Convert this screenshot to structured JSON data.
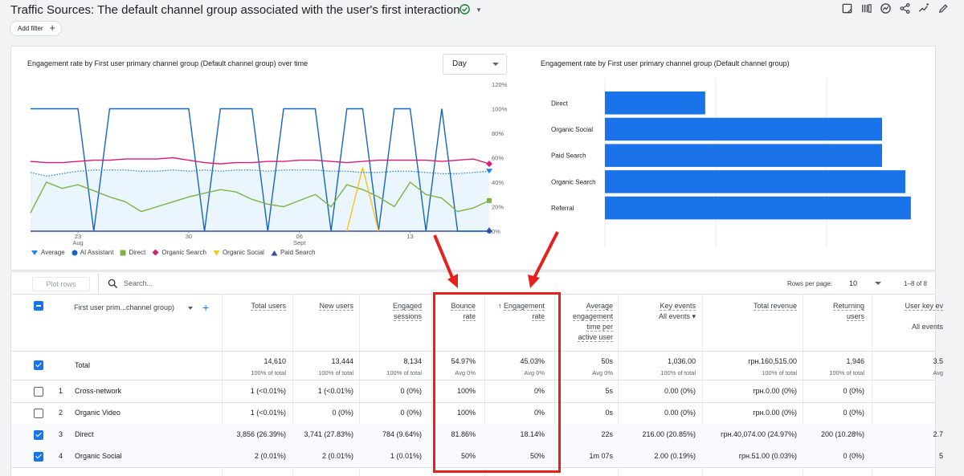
{
  "header": {
    "title": "Traffic Sources: The default channel group associated with the user's first interaction",
    "add_filter": "Add filter"
  },
  "line_chart": {
    "title": "Engagement rate by First user primary channel group (Default channel group) over time",
    "granularity": "Day",
    "y_ticks": [
      "120%",
      "100%",
      "80%",
      "60%",
      "40%",
      "20%",
      "0%"
    ],
    "x_ticks": [
      {
        "day": "23",
        "month": "Aug"
      },
      {
        "day": "30",
        "month": ""
      },
      {
        "day": "06",
        "month": "Sept"
      },
      {
        "day": "13",
        "month": ""
      }
    ],
    "legend": [
      "Average",
      "AI Assistant",
      "Direct",
      "Organic Search",
      "Organic Social",
      "Paid Search"
    ]
  },
  "chart_data": [
    {
      "type": "line",
      "title": "Engagement rate by First user primary channel group (Default channel group) over time",
      "x_tick_labels": [
        "23 Aug",
        "30",
        "06 Sept",
        "13"
      ],
      "ylim": [
        0,
        120
      ],
      "y_unit": "%",
      "series": [
        {
          "name": "Average",
          "color": "#1e88e5",
          "values": [
            48,
            45,
            47,
            49,
            50,
            50,
            50,
            49,
            49,
            50,
            49,
            50,
            49,
            50,
            50,
            49,
            50,
            50,
            50,
            49,
            49,
            48,
            48,
            49,
            49,
            48,
            47,
            47,
            48,
            49
          ]
        },
        {
          "name": "AI Assistant",
          "color": "#1565c0",
          "values": [
            100,
            100,
            100,
            100,
            0,
            100,
            100,
            100,
            100,
            100,
            100,
            0,
            100,
            100,
            100,
            0,
            100,
            100,
            100,
            0,
            100,
            100,
            0,
            100,
            100,
            0,
            100,
            0,
            0,
            0
          ]
        },
        {
          "name": "Direct",
          "color": "#7cb342",
          "values": [
            15,
            40,
            35,
            38,
            33,
            28,
            24,
            16,
            20,
            24,
            28,
            31,
            34,
            32,
            26,
            22,
            20,
            25,
            30,
            20,
            38,
            34,
            28,
            20,
            40,
            30,
            27,
            16,
            19,
            25
          ]
        },
        {
          "name": "Organic Search",
          "color": "#d81b7f",
          "values": [
            57,
            56,
            56,
            57,
            58,
            58,
            59,
            59,
            59,
            60,
            58,
            56,
            55,
            56,
            56,
            57,
            57,
            58,
            58,
            57,
            56,
            57,
            58,
            58,
            58,
            58,
            57,
            58,
            59,
            55
          ]
        },
        {
          "name": "Organic Social",
          "color": "#f9c513",
          "values": [
            null,
            null,
            null,
            null,
            null,
            null,
            null,
            null,
            null,
            null,
            null,
            null,
            null,
            null,
            null,
            null,
            null,
            null,
            null,
            null,
            0,
            52,
            0,
            null,
            null,
            null,
            null,
            null,
            null,
            null
          ]
        },
        {
          "name": "Paid Search",
          "color": "#3949ab",
          "values": [
            0,
            0,
            0,
            0,
            0,
            0,
            0,
            0,
            0,
            0,
            0,
            0,
            0,
            0,
            0,
            0,
            0,
            0,
            0,
            0,
            0,
            0,
            0,
            0,
            0,
            0,
            0,
            0,
            0,
            0
          ]
        }
      ]
    },
    {
      "type": "bar",
      "title": "Engagement rate by First user primary channel group (Default channel group)",
      "categories": [
        "Direct",
        "Organic Social",
        "Paid Search",
        "Organic Search",
        "Referral"
      ],
      "values": [
        18.1,
        50,
        50,
        54.2,
        55.2
      ],
      "xlim": [
        0,
        60
      ],
      "x_ticks": [
        "0%",
        "20%",
        "40%",
        "60%"
      ],
      "color": "#1a73e8"
    }
  ],
  "bar_chart": {
    "title": "Engagement rate by First user primary channel group (Default channel group)"
  },
  "table": {
    "plot_rows": "Plot rows",
    "search_placeholder": "Search...",
    "rows_per_page_label": "Rows per page:",
    "rows_per_page": "10",
    "pagination": "1–8 of 8",
    "dimension_label": "First user prim...channel group)",
    "columns": [
      {
        "l1": "Total users",
        "l2": "",
        "l3": "",
        "l4": ""
      },
      {
        "l1": "New users",
        "l2": "",
        "l3": "",
        "l4": ""
      },
      {
        "l1": "Engaged",
        "l2": "sessions",
        "l3": "",
        "l4": ""
      },
      {
        "l1": "Bounce",
        "l2": "rate",
        "l3": "",
        "l4": ""
      },
      {
        "l1": "Engagement",
        "l2": "rate",
        "l3": "",
        "l4": ""
      },
      {
        "l1": "Average",
        "l2": "engagement",
        "l3": "time per",
        "l4": "active user"
      },
      {
        "l1": "Key events",
        "l2": "All events",
        "l3": "",
        "l4": ""
      },
      {
        "l1": "Total revenue",
        "l2": "",
        "l3": "",
        "l4": ""
      },
      {
        "l1": "Returning",
        "l2": "users",
        "l3": "",
        "l4": ""
      },
      {
        "l1": "User key ev",
        "l2": "All events",
        "l3": "",
        "l4": ""
      }
    ],
    "total": {
      "label": "Total",
      "values": [
        "14,610",
        "13,444",
        "8,134",
        "54.97%",
        "45.03%",
        "50s",
        "1,036.00",
        "грн.160,515.00",
        "1,946",
        "3.5"
      ],
      "subs": [
        "100% of total",
        "100% of total",
        "100% of total",
        "Avg 0%",
        "Avg 0%",
        "Avg 0%",
        "100% of total",
        "100% of total",
        "100% of total",
        "Avg"
      ]
    },
    "rows": [
      {
        "n": "1",
        "name": "Cross-network",
        "checked": false,
        "values": [
          "1 (<0.01%)",
          "1 (<0.01%)",
          "0 (0%)",
          "100%",
          "0%",
          "5s",
          "0.00 (0%)",
          "грн.0.00 (0%)",
          "0 (0%)",
          ""
        ]
      },
      {
        "n": "2",
        "name": "Organic Video",
        "checked": false,
        "values": [
          "1 (<0.01%)",
          "0 (0%)",
          "0 (0%)",
          "100%",
          "0%",
          "0s",
          "0.00 (0%)",
          "грн.0.00 (0%)",
          "0 (0%)",
          ""
        ]
      },
      {
        "n": "3",
        "name": "Direct",
        "checked": true,
        "values": [
          "3,856 (26.39%)",
          "3,741 (27.83%)",
          "784 (9.64%)",
          "81.86%",
          "18.14%",
          "22s",
          "216.00 (20.85%)",
          "грн.40,074.00 (24.97%)",
          "200 (10.28%)",
          "2.7"
        ]
      },
      {
        "n": "4",
        "name": "Organic Social",
        "checked": true,
        "values": [
          "2 (0.01%)",
          "2 (0.01%)",
          "1 (0.01%)",
          "50%",
          "50%",
          "1m 07s",
          "2.00 (0.19%)",
          "грн.51.00 (0.03%)",
          "0 (0%)",
          "5"
        ]
      }
    ]
  },
  "colors": {
    "accent": "#1a73e8",
    "highlight_box": "#e8201c"
  }
}
